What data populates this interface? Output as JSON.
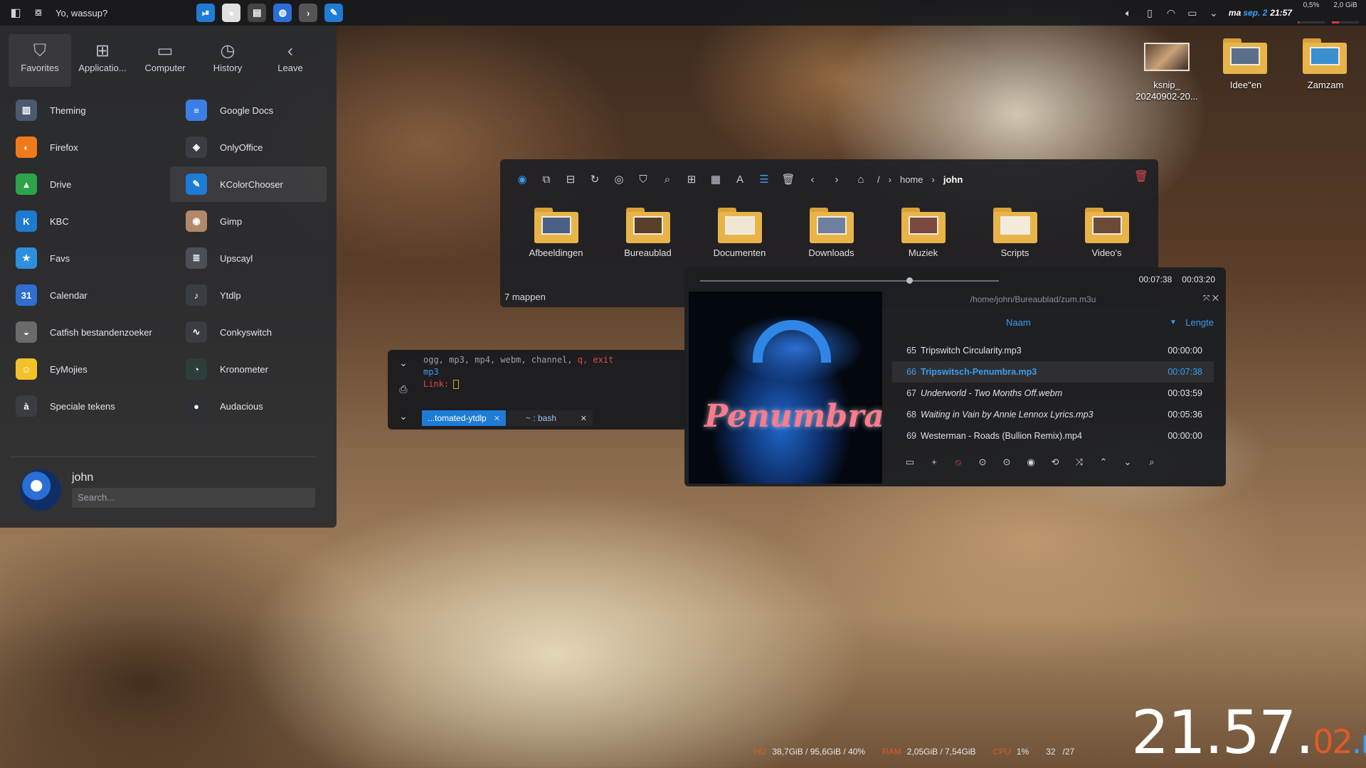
{
  "panel": {
    "greeting": "Yo, wassup?",
    "tasks": [
      {
        "icon": "media-play-pause-icon",
        "color": "#1e7bd6",
        "glyph": "⏯"
      },
      {
        "icon": "screen-recorder-icon",
        "color": "#e0e0e0",
        "glyph": "●"
      },
      {
        "icon": "clapperboard-icon",
        "color": "#444",
        "glyph": "▤"
      },
      {
        "icon": "globe-app-icon",
        "color": "#2a6fd6",
        "glyph": "◍"
      },
      {
        "icon": "terminal-icon",
        "color": "#555",
        "glyph": "›"
      },
      {
        "icon": "kcolorchooser-icon",
        "color": "#1e7bd6",
        "glyph": "✎"
      }
    ],
    "tray": {
      "day": "ma",
      "date": "sep. 2",
      "time": "21:57",
      "cpu_pct": "0,5%",
      "mem": "2,0 GiB",
      "cpu_fill": 0.05,
      "mem_fill": 0.27
    }
  },
  "launcher": {
    "tabs": [
      {
        "label": "Favorites",
        "icon": "bookmark-icon",
        "glyph": "⛉"
      },
      {
        "label": "Applicatio...",
        "icon": "grid-icon",
        "glyph": "⊞"
      },
      {
        "label": "Computer",
        "icon": "monitor-icon",
        "glyph": "▭"
      },
      {
        "label": "History",
        "icon": "clock-icon",
        "glyph": "◷"
      },
      {
        "label": "Leave",
        "icon": "chevron-left-circle-icon",
        "glyph": "‹"
      }
    ],
    "apps_left": [
      {
        "label": "Theming",
        "icon": "theming-icon",
        "color": "#4a5a70",
        "glyph": "▥"
      },
      {
        "label": "Firefox",
        "icon": "firefox-icon",
        "color": "#f07a1a",
        "glyph": "◐"
      },
      {
        "label": "Drive",
        "icon": "google-drive-icon",
        "color": "#2da34a",
        "glyph": "▲"
      },
      {
        "label": "KBC",
        "icon": "kbc-icon",
        "color": "#1f7bd0",
        "glyph": "K"
      },
      {
        "label": "Favs",
        "icon": "favs-icon",
        "color": "#2d8fe0",
        "glyph": "★"
      },
      {
        "label": "Calendar",
        "icon": "calendar-icon",
        "color": "#2f6fd0",
        "glyph": "31"
      },
      {
        "label": "Catfish bestandenzoeker",
        "icon": "catfish-icon",
        "color": "#6b6b6b",
        "glyph": "◒"
      },
      {
        "label": "EyMojies",
        "icon": "emoji-icon",
        "color": "#f2c228",
        "glyph": "☺"
      },
      {
        "label": "Speciale tekens",
        "icon": "special-chars-icon",
        "color": "#3a3d42",
        "glyph": "à"
      }
    ],
    "apps_right": [
      {
        "label": "Google Docs",
        "icon": "google-docs-icon",
        "color": "#3b7ee8",
        "glyph": "≡"
      },
      {
        "label": "OnlyOffice",
        "icon": "onlyoffice-icon",
        "color": "#3a3d42",
        "glyph": "◈"
      },
      {
        "label": "KColorChooser",
        "icon": "kcolorchooser-icon",
        "color": "#1e7bd6",
        "glyph": "✎"
      },
      {
        "label": "Gimp",
        "icon": "gimp-icon",
        "color": "#b08a68",
        "glyph": "◉"
      },
      {
        "label": "Upscayl",
        "icon": "upscayl-icon",
        "color": "#4a4f58",
        "glyph": "≣"
      },
      {
        "label": "Ytdlp",
        "icon": "music-note-icon",
        "color": "#3a3d42",
        "glyph": "♪"
      },
      {
        "label": "Conkyswitch",
        "icon": "conky-icon",
        "color": "#3a3d42",
        "glyph": "∿"
      },
      {
        "label": "Kronometer",
        "icon": "stopwatch-icon",
        "color": "#2c3e3a",
        "glyph": "◔"
      },
      {
        "label": "Audacious",
        "icon": "audacious-icon",
        "color": "#2e3036",
        "glyph": "●"
      }
    ],
    "user": "john",
    "search_placeholder": "Search..."
  },
  "file_manager": {
    "breadcrumb": [
      "/",
      "home",
      "john"
    ],
    "folders": [
      {
        "label": "Afbeeldingen",
        "icon": "pictures-folder-icon"
      },
      {
        "label": "Bureaublad",
        "icon": "desktop-folder-icon"
      },
      {
        "label": "Documenten",
        "icon": "documents-folder-icon"
      },
      {
        "label": "Downloads",
        "icon": "downloads-folder-icon"
      },
      {
        "label": "Muziek",
        "icon": "music-folder-icon"
      },
      {
        "label": "Scripts",
        "icon": "scripts-folder-icon"
      },
      {
        "label": "Video's",
        "icon": "videos-folder-icon"
      }
    ],
    "status": "7 mappen"
  },
  "terminal": {
    "line1_prefix": "ogg, mp3, mp4, webm, channel, ",
    "line1_q": "q, exit",
    "line2": "mp3",
    "line3": "Link:",
    "tabs": [
      {
        "label": "...tomated-ytdlp"
      },
      {
        "label": "~ : bash"
      }
    ]
  },
  "player": {
    "elapsed": "00:07:38",
    "remaining": "00:03:20",
    "progress": 0.7,
    "playlist_path": "/home/john/Bureaublad/zum.m3u",
    "cover_text": "Penumbra",
    "col_name": "Naam",
    "col_length": "Lengte",
    "tracks": [
      {
        "num": "65",
        "name": "Tripswitch Circularity.mp3",
        "len": "00:00:00",
        "current": false,
        "italic": false
      },
      {
        "num": "66",
        "name": "Tripswitsch-Penumbra.mp3",
        "len": "00:07:38",
        "current": true,
        "italic": false
      },
      {
        "num": "67",
        "name": "Underworld - Two Months Off.webm",
        "len": "00:03:59",
        "current": false,
        "italic": true
      },
      {
        "num": "68",
        "name": "Waiting in Vain by Annie Lennox Lyrics.mp3",
        "len": "00:05:36",
        "current": false,
        "italic": true
      },
      {
        "num": "69",
        "name": "Westerman - Roads (Bullion Remix).mp4",
        "len": "00:00:00",
        "current": false,
        "italic": false
      }
    ]
  },
  "desktop": {
    "icons": [
      {
        "label_1": "ksnip_",
        "label_2": "20240902-20...",
        "icon": "screenshot-file-icon"
      },
      {
        "label_1": "Idee\"en",
        "label_2": "",
        "icon": "folder-icon"
      },
      {
        "label_1": "Zamzam",
        "label_2": "",
        "icon": "folder-icon"
      }
    ]
  },
  "conky": {
    "hd_label": "HD",
    "hd_val": "38,7GiB / 95,6GiB / 40%",
    "ram_label": "RAM",
    "ram_val": "2,05GiB / 7,54GiB",
    "cpu_label": "CPU",
    "cpu_val": "1%",
    "temp1": "32",
    "temp2": "/27",
    "clock_h": "21",
    "clock_m": "57",
    "clock_s": "02",
    "clock_day": "ma"
  }
}
